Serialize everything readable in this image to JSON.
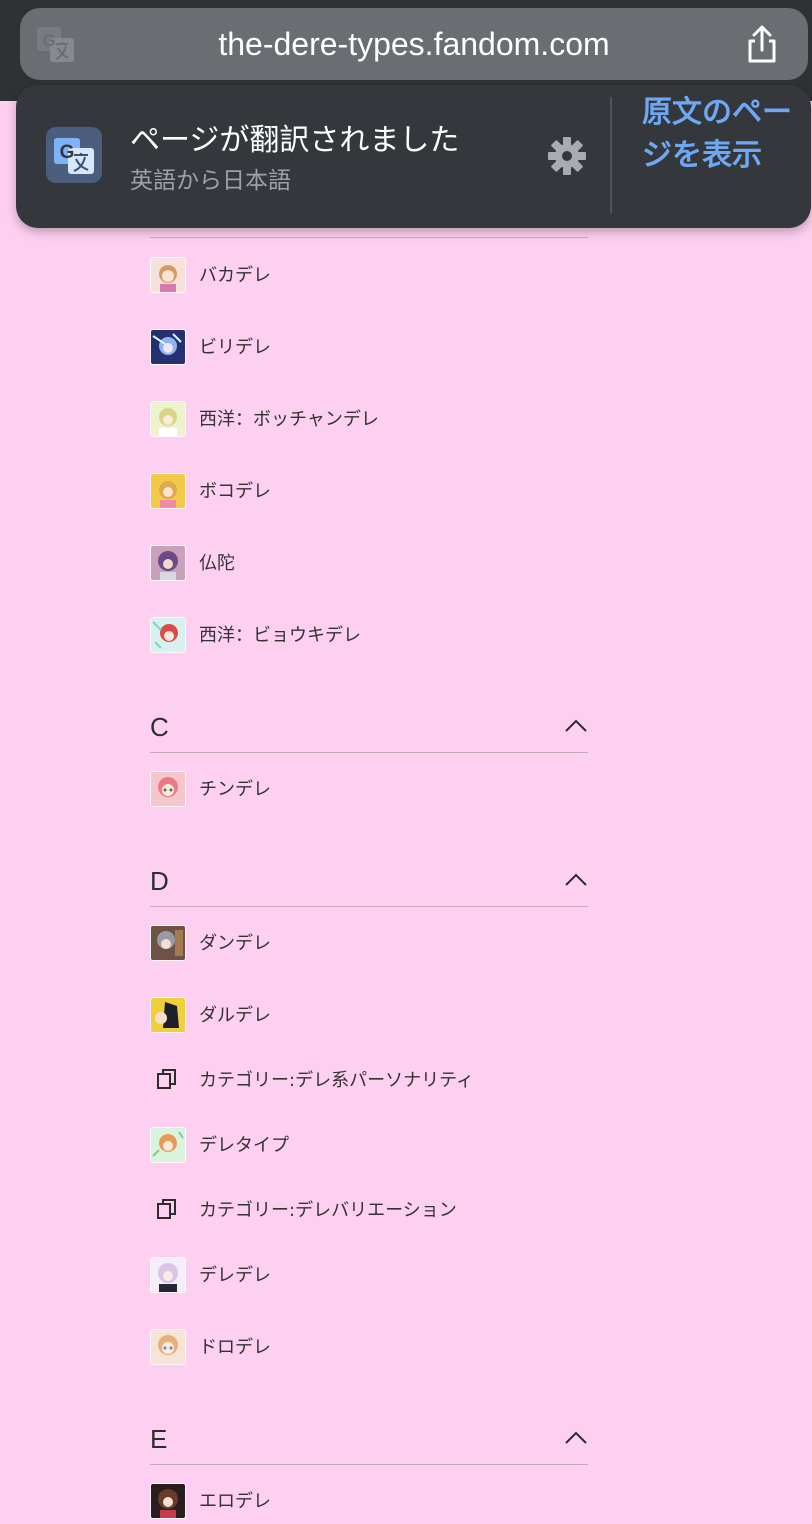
{
  "browser": {
    "url": "the-dere-types.fandom.com",
    "translate_icon": "translate-icon",
    "share_icon": "share-icon"
  },
  "translation_banner": {
    "title": "ページが翻訳されました",
    "subtitle": "英語から日本語",
    "settings_icon": "gear-icon",
    "show_original_label": "原文のページを表示"
  },
  "colors": {
    "page_background": "#fdcff0",
    "banner_background": "#34373b",
    "link_blue": "#6ea8f4"
  },
  "sections": [
    {
      "letter": "",
      "items": [
        {
          "label": "バカデレ",
          "type": "page"
        },
        {
          "label": "ビリデレ",
          "type": "page"
        },
        {
          "label": "西洋：ボッチャンデレ",
          "type": "page"
        },
        {
          "label": "ボコデレ",
          "type": "page"
        },
        {
          "label": "仏陀",
          "type": "page"
        },
        {
          "label": "西洋：ビョウキデレ",
          "type": "page"
        }
      ]
    },
    {
      "letter": "C",
      "items": [
        {
          "label": "チンデレ",
          "type": "page"
        }
      ]
    },
    {
      "letter": "D",
      "items": [
        {
          "label": "ダンデレ",
          "type": "page"
        },
        {
          "label": "ダルデレ",
          "type": "page"
        },
        {
          "label": "カテゴリー:デレ系パーソナリティ",
          "type": "category"
        },
        {
          "label": "デレタイプ",
          "type": "page"
        },
        {
          "label": "カテゴリー:デレバリエーション",
          "type": "category"
        },
        {
          "label": "デレデレ",
          "type": "page"
        },
        {
          "label": "ドロデレ",
          "type": "page"
        }
      ]
    },
    {
      "letter": "E",
      "items": [
        {
          "label": "エロデレ",
          "type": "page"
        }
      ]
    }
  ]
}
